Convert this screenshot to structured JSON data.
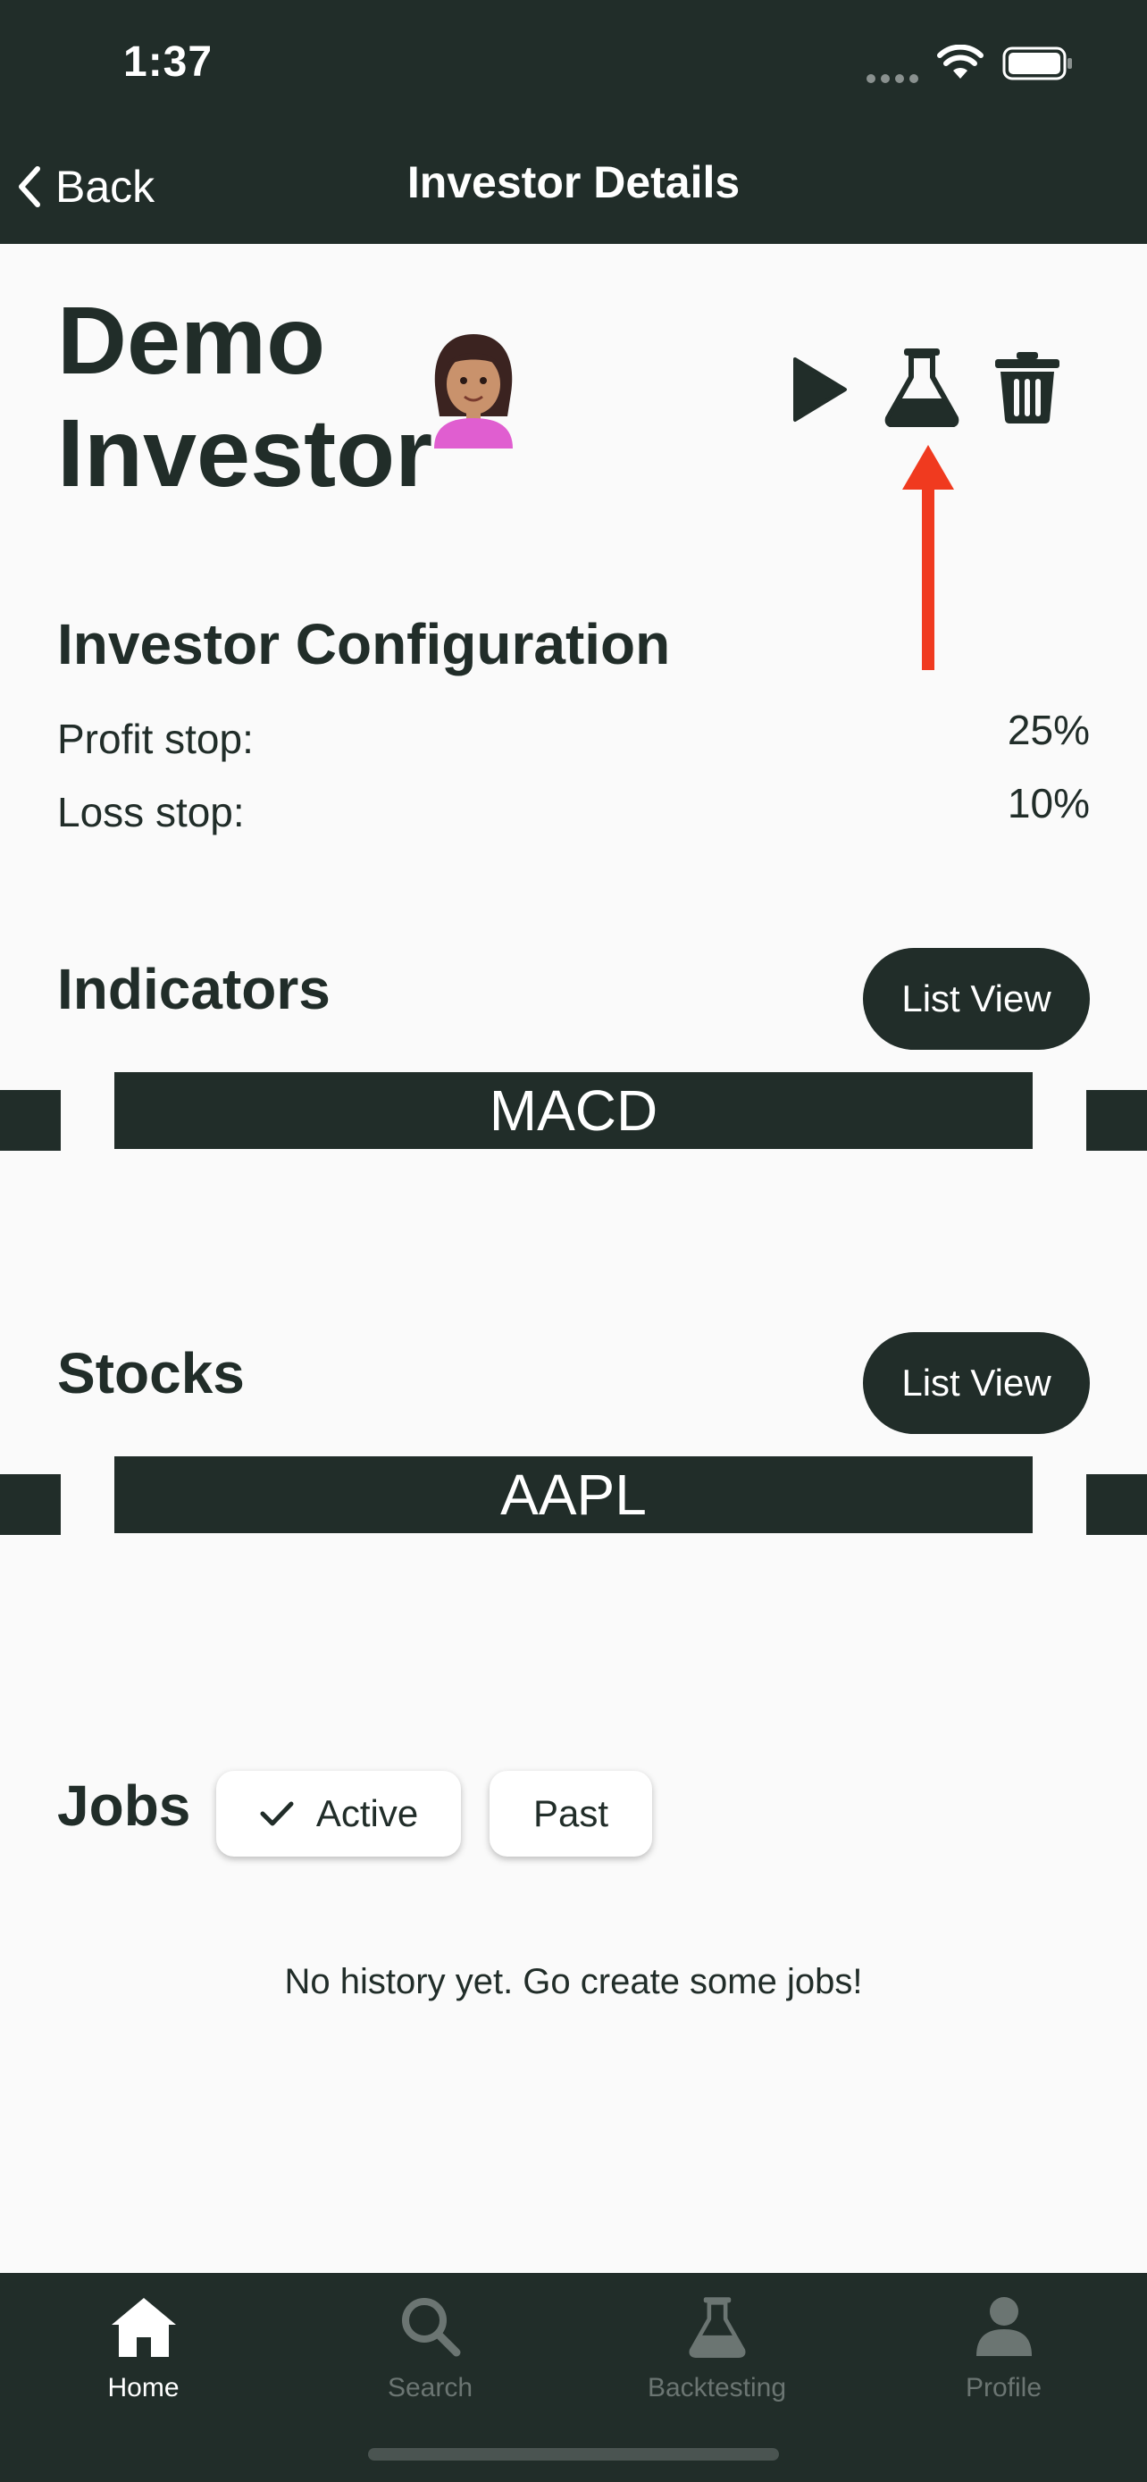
{
  "status_bar": {
    "time": "1:37"
  },
  "nav": {
    "back_label": "Back",
    "title": "Investor Details"
  },
  "investor": {
    "name_line1": "Demo",
    "name_line2": "Investor",
    "avatar": "woman-emoji"
  },
  "actions": {
    "icons": [
      "play-icon",
      "flask-icon",
      "trash-icon"
    ],
    "annotation_color": "#f03a1f"
  },
  "configuration": {
    "title": "Investor Configuration",
    "rows": [
      {
        "label": "Profit stop:",
        "value": "25%"
      },
      {
        "label": "Loss stop:",
        "value": "10%"
      }
    ]
  },
  "indicators": {
    "title": "Indicators",
    "list_view_label": "List View",
    "items": [
      "MACD"
    ]
  },
  "stocks": {
    "title": "Stocks",
    "list_view_label": "List View",
    "items": [
      "AAPL"
    ]
  },
  "jobs": {
    "title": "Jobs",
    "filters": [
      {
        "label": "Active",
        "selected": true
      },
      {
        "label": "Past",
        "selected": false
      }
    ],
    "empty_message": "No history yet. Go create some jobs!"
  },
  "tab_bar": {
    "items": [
      {
        "label": "Home",
        "icon": "home-icon",
        "active": true
      },
      {
        "label": "Search",
        "icon": "search-icon",
        "active": false
      },
      {
        "label": "Backtesting",
        "icon": "flask-icon",
        "active": false
      },
      {
        "label": "Profile",
        "icon": "person-icon",
        "active": false
      }
    ]
  },
  "colors": {
    "primary": "#212d29",
    "background": "#fafafa",
    "inactive_tab": "#6b7572"
  }
}
